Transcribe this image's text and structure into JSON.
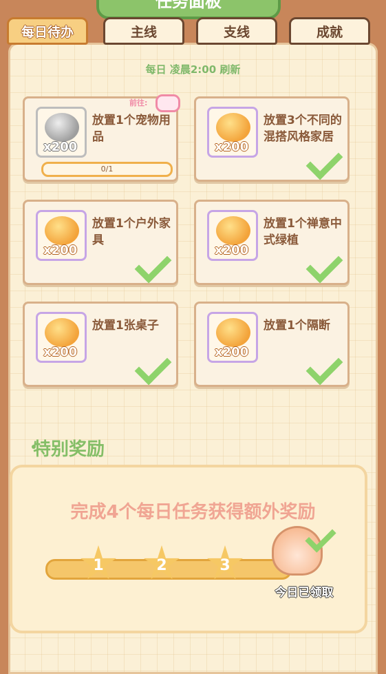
{
  "panel": {
    "title": "任务面板"
  },
  "tabs": [
    {
      "label": "每日待办"
    },
    {
      "label": "主线"
    },
    {
      "label": "支线"
    },
    {
      "label": "成就"
    }
  ],
  "refresh_text": "每日 凌晨2:00 刷新",
  "tasks": [
    {
      "title": "放置1个宠物用品",
      "reward": "x200",
      "progress": "0/1",
      "goto": "前往:",
      "completed": false
    },
    {
      "title": "放置3个不同的混搭风格家居",
      "reward": "x200",
      "completed": true
    },
    {
      "title": "放置1个户外家具",
      "reward": "x200",
      "completed": true
    },
    {
      "title": "放置1个禅意中式绿植",
      "reward": "x200",
      "completed": true
    },
    {
      "title": "放置1张桌子",
      "reward": "x200",
      "completed": true
    },
    {
      "title": "放置1个隔断",
      "reward": "x200",
      "completed": true
    }
  ],
  "special": {
    "heading": "特别奖励",
    "description": "完成4个每日任务获得额外奖励",
    "stars": [
      "1",
      "2",
      "3"
    ],
    "claimed_label": "今日已领取"
  },
  "colors": {
    "accent_green": "#84be67",
    "frame_brown": "#c8865a",
    "coin_gold": "#f3a33a",
    "check_green": "#8ed36b"
  }
}
